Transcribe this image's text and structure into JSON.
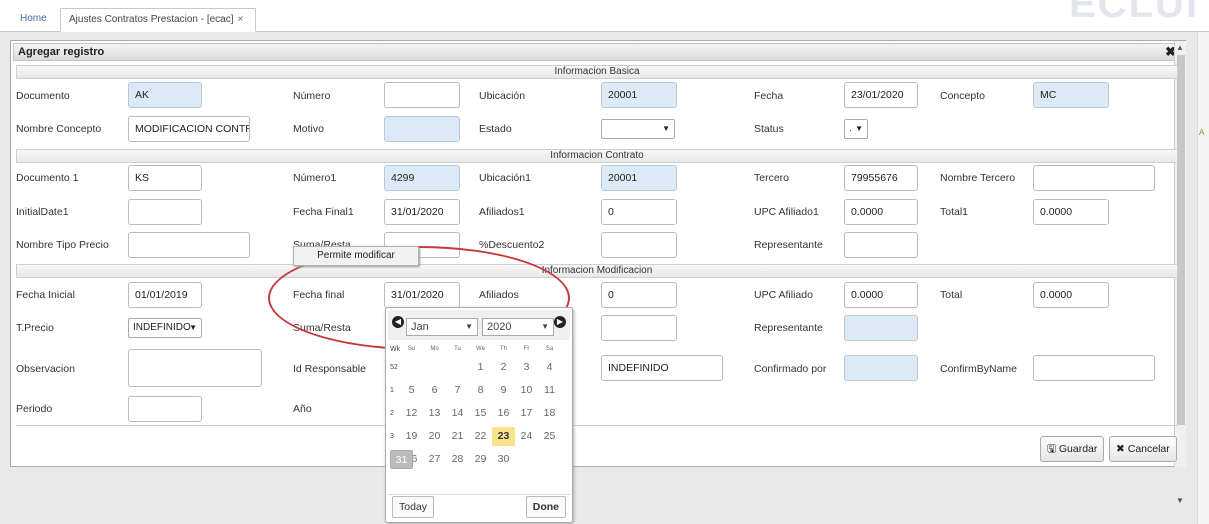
{
  "tabs": [
    {
      "label": "Home"
    },
    {
      "label": "Ajustes Contratos Prestacion - [ecac]",
      "close": "×"
    }
  ],
  "dialog": {
    "title": "Agregar registro",
    "close": "✖",
    "sections": {
      "basica": "Informacion Basica",
      "contrato": "Informacion Contrato",
      "modificacion": "Informacion Modificacion"
    },
    "fields": {
      "documento": {
        "label": "Documento",
        "value": "AK"
      },
      "numero": {
        "label": "Número",
        "value": ""
      },
      "ubicacion": {
        "label": "Ubicación",
        "value": "20001"
      },
      "fecha": {
        "label": "Fecha",
        "value": "23/01/2020"
      },
      "concepto": {
        "label": "Concepto",
        "value": "MC"
      },
      "nombre_concepto": {
        "label": "Nombre Concepto",
        "value": "MODIFICACION CONTRAT"
      },
      "motivo": {
        "label": "Motivo",
        "value": ""
      },
      "estado": {
        "label": "Estado",
        "value": ""
      },
      "status": {
        "label": "Status",
        "value": "."
      },
      "documento1": {
        "label": "Documento 1",
        "value": "KS"
      },
      "numero1": {
        "label": "Número1",
        "value": "4299"
      },
      "ubicacion1": {
        "label": "Ubicación1",
        "value": "20001"
      },
      "tercero": {
        "label": "Tercero",
        "value": "79955676"
      },
      "nombre_tercero": {
        "label": "Nombre Tercero",
        "value": ""
      },
      "initial_date1": {
        "label": "InitialDate1",
        "value": ""
      },
      "fecha_final1": {
        "label": "Fecha Final1",
        "value": "31/01/2020"
      },
      "afiliados1": {
        "label": "Afiliados1",
        "value": "0"
      },
      "upc_afiliado1": {
        "label": "UPC Afiliado1",
        "value": "0.0000"
      },
      "total1": {
        "label": "Total1",
        "value": "0.0000"
      },
      "nombre_tipo_precio": {
        "label": "Nombre Tipo Precio",
        "value": ""
      },
      "suma_resta1": {
        "label": "Suma/Resta",
        "value": ""
      },
      "descuento2": {
        "label": "%Descuento2",
        "value": ""
      },
      "representante1": {
        "label": "Representante",
        "value": ""
      },
      "fecha_inicial": {
        "label": "Fecha Inicial",
        "value": "01/01/2019"
      },
      "fecha_final": {
        "label": "Fecha final",
        "value": "31/01/2020"
      },
      "afiliados": {
        "label": "Afiliados",
        "value": "0"
      },
      "upc_afiliado": {
        "label": "UPC Afiliado",
        "value": "0.0000"
      },
      "total": {
        "label": "Total",
        "value": "0.0000"
      },
      "tprecio": {
        "label": "T.Precio",
        "value": "INDEFINIDO"
      },
      "suma_resta": {
        "label": "Suma/Resta",
        "value": ""
      },
      "representante": {
        "label": "Representante",
        "value": ""
      },
      "observacion": {
        "label": "Observacion",
        "value": ""
      },
      "id_responsable": {
        "label": "Id Responsable",
        "value": ""
      },
      "responsable_name": {
        "value": "INDEFINIDO"
      },
      "confirmado_por": {
        "label": "Confirmado por",
        "value": ""
      },
      "confirm_by_name": {
        "label": "ConfirmByName",
        "value": ""
      },
      "periodo": {
        "label": "Periodo",
        "value": ""
      },
      "anio": {
        "label": "Año",
        "value": ""
      }
    },
    "buttons": {
      "guardar": "Guardar",
      "cancelar": "Cancelar"
    },
    "tooltip": "Permite modificar"
  },
  "datepicker": {
    "month": "Jan",
    "year": "2020",
    "day_names": [
      "Wk",
      "Su",
      "Mo",
      "Tu",
      "We",
      "Th",
      "Fr",
      "Sa"
    ],
    "weeks": [
      {
        "wk": "52",
        "days": [
          "",
          "",
          "",
          "1",
          "2",
          "3",
          "4"
        ]
      },
      {
        "wk": "1",
        "days": [
          "5",
          "6",
          "7",
          "8",
          "9",
          "10",
          "11"
        ]
      },
      {
        "wk": "2",
        "days": [
          "12",
          "13",
          "14",
          "15",
          "16",
          "17",
          "18"
        ]
      },
      {
        "wk": "3",
        "days": [
          "19",
          "20",
          "21",
          "22",
          "23",
          "24",
          "25"
        ]
      },
      {
        "wk": "4",
        "days": [
          "26",
          "27",
          "28",
          "29",
          "30",
          "31",
          ""
        ]
      }
    ],
    "today": "23",
    "selected": "31",
    "today_button": "Today",
    "done_button": "Done"
  },
  "colors": {
    "input_blue": "#dceaf7",
    "today_highlight": "#fbe28a",
    "callout": "#c43a3a"
  }
}
